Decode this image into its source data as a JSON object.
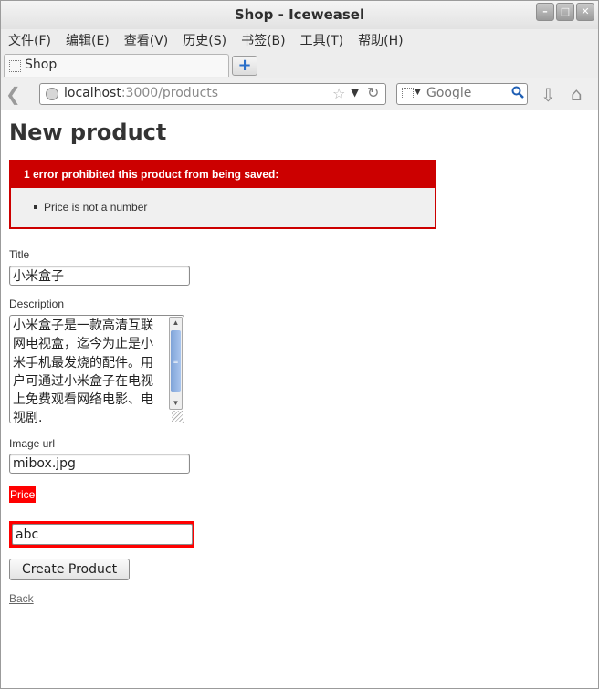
{
  "window": {
    "title": "Shop - Iceweasel",
    "controls": [
      "minimize",
      "maximize",
      "close"
    ]
  },
  "menu": [
    "文件(F)",
    "编辑(E)",
    "查看(V)",
    "历史(S)",
    "书签(B)",
    "工具(T)",
    "帮助(H)"
  ],
  "tabs": [
    {
      "label": "Shop",
      "icon": "page-icon"
    }
  ],
  "navbar": {
    "url_host": "localhost",
    "url_path": ":3000/products",
    "search_placeholder": "Google"
  },
  "page": {
    "title": "New product",
    "error": {
      "header": "1 error prohibited this product from being saved:",
      "messages": [
        "Price is not a number"
      ]
    },
    "fields": {
      "title_label": "Title",
      "title_value": "小米盒子",
      "description_label": "Description",
      "description_value": "小米盒子是一款高清互联网电视盒，迄今为止是小米手机最发烧的配件。用户可通过小米盒子在电视上免费观看网络电影、电视剧.",
      "image_url_label": "Image url",
      "image_url_value": "mibox.jpg",
      "price_label": "Price",
      "price_value": "abc"
    },
    "submit_label": "Create Product",
    "back_link": "Back"
  },
  "colors": {
    "error_red": "#cc0000",
    "field_error_red": "#ff0000",
    "error_bg": "#f0f0f0"
  }
}
